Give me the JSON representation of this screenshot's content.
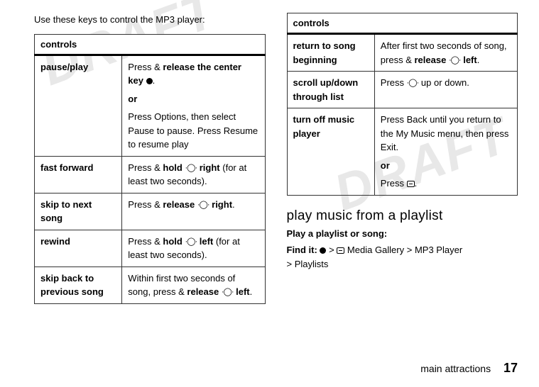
{
  "watermark": "DRAFT",
  "intro": "Use these keys to control the MP3 player:",
  "table_header": "controls",
  "left_rows": [
    {
      "label": "pause/play",
      "p1_pre": "Press & ",
      "p1_bold": "release the center key",
      "p1_post": ".",
      "or": "or",
      "p2_pre": "Press ",
      "p2_b1": "Options",
      "p2_mid": ", then select ",
      "p2_b2": "Pause",
      "p2_mid2": " to pause. Press ",
      "p2_b3": "Resume",
      "p2_post": " to resume play"
    },
    {
      "label": "fast forward",
      "t_pre": "Press & ",
      "t_b1": "hold",
      "t_mid": " ",
      "t_b2": "right",
      "t_post": " (for at least two seconds)."
    },
    {
      "label": "skip to next song",
      "t_pre": "Press & ",
      "t_b1": "release",
      "t_b2": "right",
      "t_post": "."
    },
    {
      "label": "rewind",
      "t_pre": "Press & ",
      "t_b1": "hold",
      "t_b2": "left",
      "t_post": " (for at least two seconds)."
    },
    {
      "label": "skip back to previous song",
      "t_pre": "Within first two seconds of song, press & ",
      "t_b1": "release",
      "t_b2": "left",
      "t_post": "."
    }
  ],
  "right_rows": [
    {
      "label": "return to song beginning",
      "t_pre": "After first two seconds of song, press & ",
      "t_b1": "release",
      "t_b2": "left",
      "t_post": "."
    },
    {
      "label": "scroll up/down through list",
      "t_pre": "Press ",
      "t_post": " up or down."
    },
    {
      "label": "turn off music player",
      "t_pre": "Press ",
      "t_b1": "Back",
      "t_mid": " until you return to the ",
      "t_b2": "My Music",
      "t_mid2": " menu, then press ",
      "t_b3": "Exit",
      "t_post": ".",
      "or": "or",
      "p2_pre": "Press ",
      "p2_post": "."
    }
  ],
  "section_heading": "play music from a playlist",
  "subhead": "Play a playlist or song:",
  "findit_label": "Find it:",
  "findit_gt": ">",
  "findit_item1": "Media Gallery",
  "findit_item2": "MP3 Player",
  "findit_item3": "Playlists",
  "footer_label": "main attractions",
  "page_number": "17"
}
